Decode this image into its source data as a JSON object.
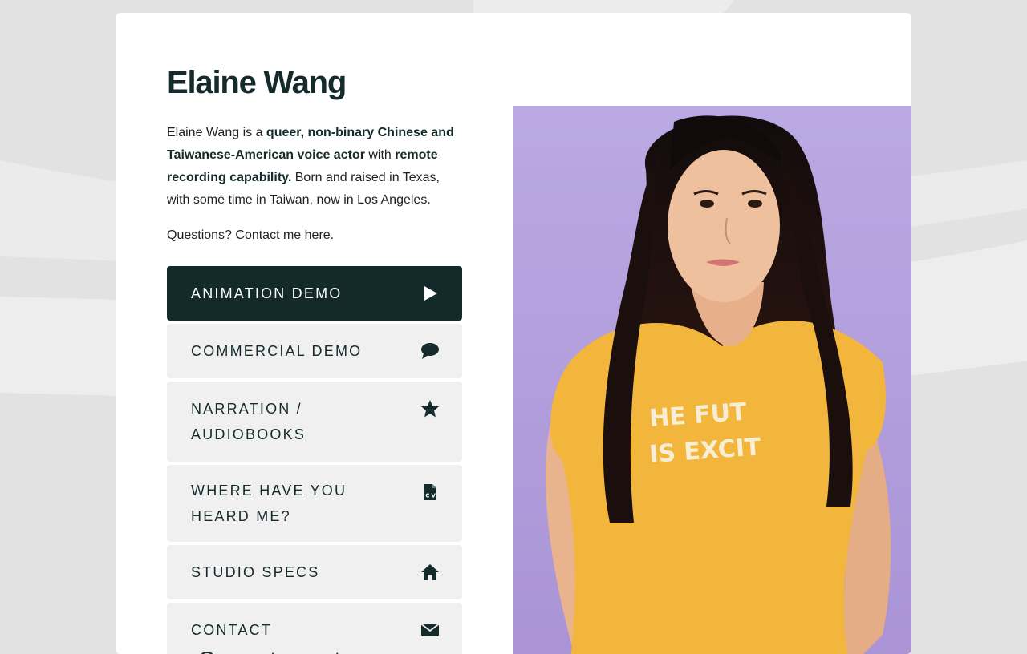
{
  "profile": {
    "name": "Elaine Wang",
    "bio_intro": "Elaine Wang is a ",
    "bio_strong_1": "queer, non-binary Chinese and Taiwanese-American voice actor",
    "bio_with": " with ",
    "bio_strong_2": "remote recording capability.",
    "bio_rest": " Born and raised in Texas, with some time in Taiwan, now in Los Angeles.",
    "contact_prefix": "Questions? Contact me ",
    "contact_link": "here",
    "contact_suffix": "."
  },
  "menu": [
    {
      "label": "ANIMATION DEMO",
      "icon": "play-icon",
      "active": true
    },
    {
      "label": "COMMERCIAL DEMO",
      "icon": "speech-bubble-icon",
      "active": false
    },
    {
      "label": "NARRATION / AUDIOBOOKS",
      "icon": "star-icon",
      "active": false
    },
    {
      "label": "WHERE HAVE YOU HEARD ME?",
      "icon": "cv-file-icon",
      "active": false
    },
    {
      "label": "STUDIO SPECS",
      "icon": "home-icon",
      "active": false
    },
    {
      "label": "CONTACT",
      "icon": "envelope-icon",
      "active": false
    }
  ],
  "photo": {
    "shirt_text_line1": "HE FUT",
    "shirt_text_line2": "IS EXCIT"
  },
  "colors": {
    "accent": "#142a2a",
    "button_bg": "#f0f0f0",
    "photo_bg": "#b9a6e0",
    "shirt": "#f2b83e"
  }
}
